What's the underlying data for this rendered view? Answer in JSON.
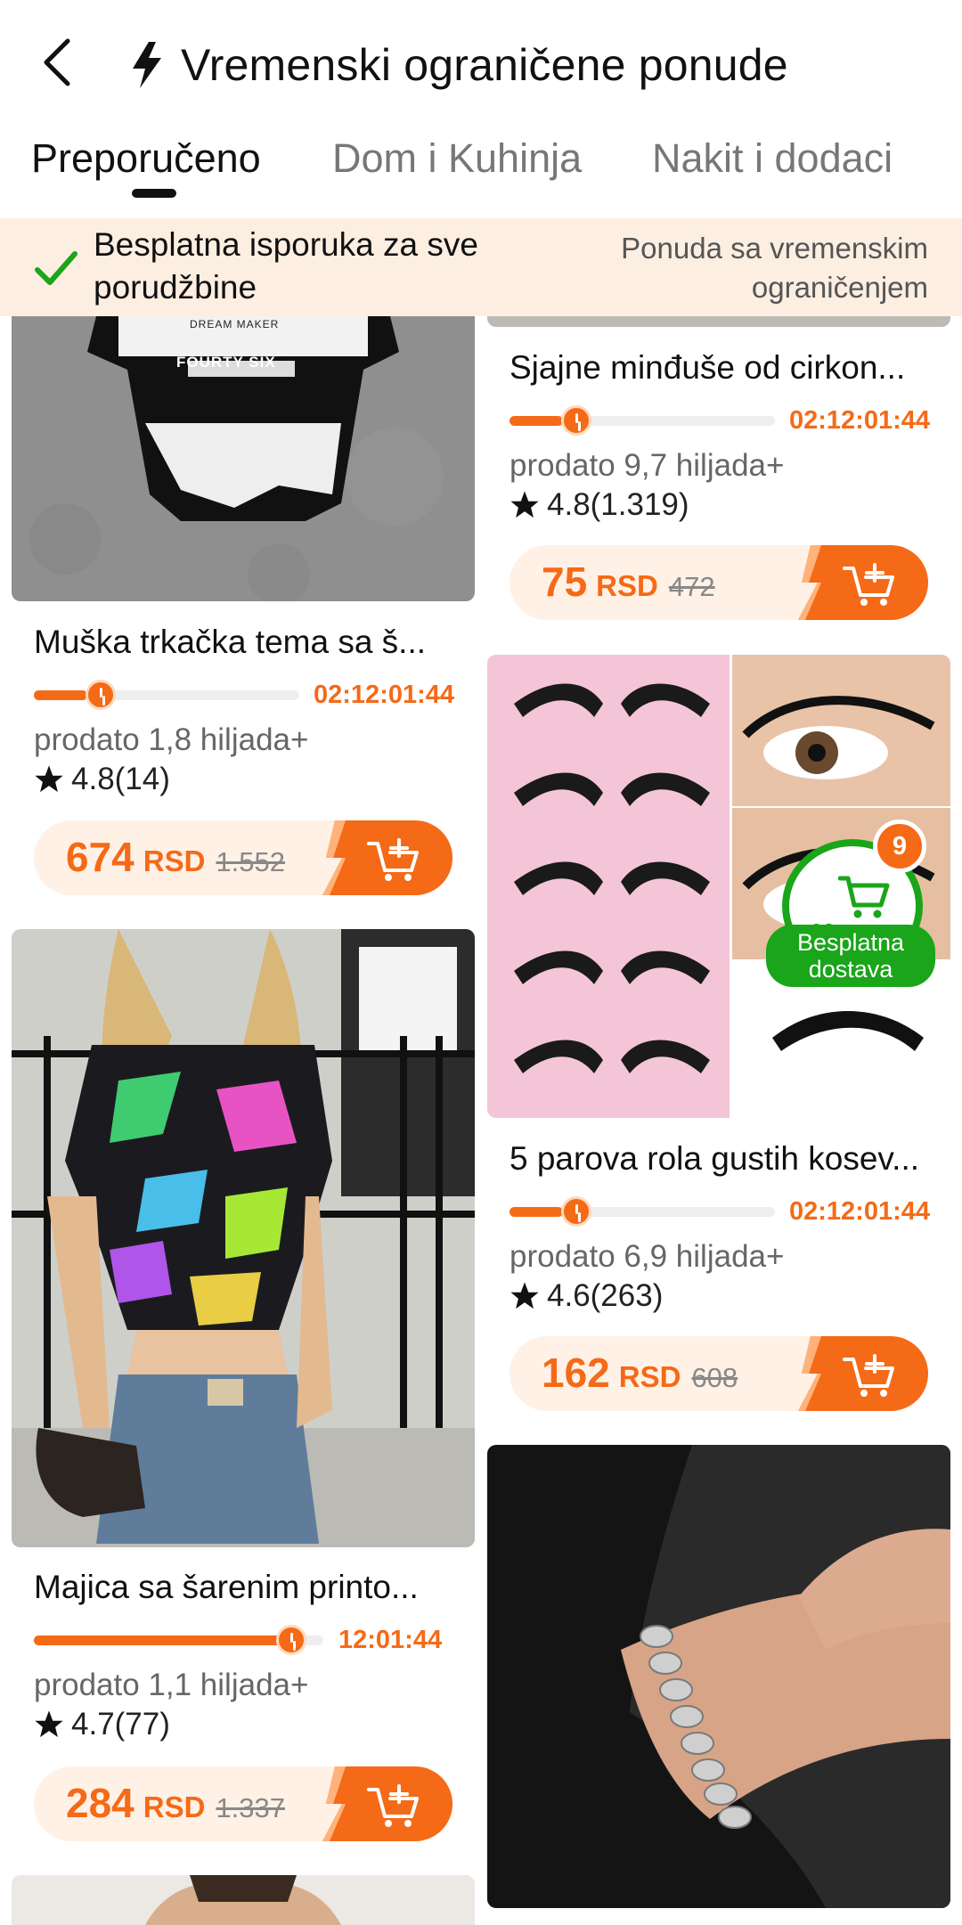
{
  "header": {
    "title": "Vremenski ograničene ponude"
  },
  "tabs": [
    {
      "label": "Preporučeno",
      "active": true
    },
    {
      "label": "Dom i Kuhinja",
      "active": false
    },
    {
      "label": "Nakit i dodaci",
      "active": false
    }
  ],
  "banner": {
    "free_shipping": "Besplatna isporuka za sve porudžbine",
    "limited_offer": "Ponuda sa vremenskim ograničenjem"
  },
  "products": [
    {
      "title": "Muška trkačka tema sa š...",
      "progress": 0.25,
      "time": "02:12:01:44",
      "sold": "prodato 1,8 hiljada+",
      "rating": "4.8",
      "reviews": "(14)",
      "price": "674",
      "currency": "RSD",
      "old_price": "1.552"
    },
    {
      "title": "Majica sa šarenim printo...",
      "progress": 0.9,
      "time": "12:01:44",
      "sold": "prodato 1,1 hiljada+",
      "rating": "4.7",
      "reviews": "(77)",
      "price": "284",
      "currency": "RSD",
      "old_price": "1.337"
    },
    {
      "title": "Sjajne minđuše od cirkon...",
      "progress": 0.25,
      "time": "02:12:01:44",
      "sold": "prodato 9,7 hiljada+",
      "rating": "4.8",
      "reviews": "(1.319)",
      "price": "75",
      "currency": "RSD",
      "old_price": "472"
    },
    {
      "title": "5 parova rola gustih kosev...",
      "progress": 0.25,
      "time": "02:12:01:44",
      "sold": "prodato 6,9 hiljada+",
      "rating": "4.6",
      "reviews": "(263)",
      "price": "162",
      "currency": "RSD",
      "old_price": "608"
    }
  ],
  "image_texts": {
    "shirt_brand": "DREAM MAKER",
    "shirt_print": "FOURTY SIX"
  },
  "cart": {
    "count": "9",
    "label": "Korpa",
    "free_delivery": "Besplatna dostava"
  },
  "colors": {
    "accent": "#f56a17",
    "green": "#1aa51a",
    "banner_bg": "#fdeee2"
  },
  "icons": [
    "back-arrow-icon",
    "lightning-icon",
    "check-icon",
    "star-icon",
    "add-to-cart-icon",
    "cart-icon",
    "clock-icon"
  ]
}
